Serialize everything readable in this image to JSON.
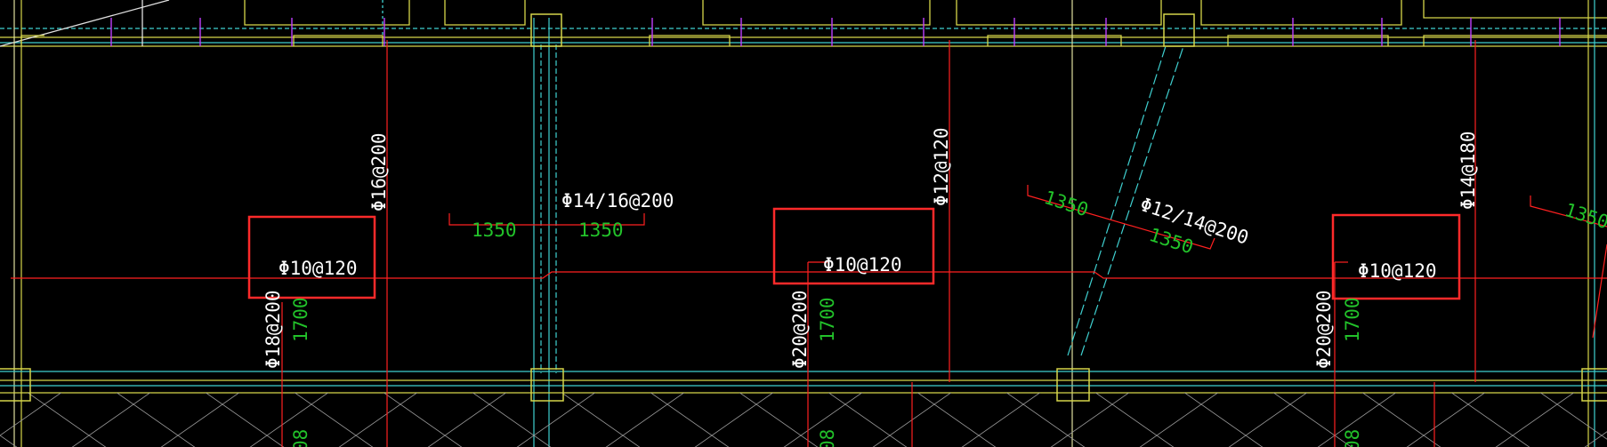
{
  "colors": {
    "background": "#000000",
    "rebar_line": "#ff2020",
    "rebar_label": "#ffffff",
    "length_label": "#22c22a",
    "column": "#d6d64a",
    "axis_line": "#3fd0d0",
    "purple_tick": "#c040ff",
    "highlight_box": "#ff2a2a",
    "grid_line": "#e0e0a0"
  },
  "drawing": {
    "rebar_labels": [
      {
        "id": "l1",
        "text": "Φ16@200"
      },
      {
        "id": "l2",
        "text": "Φ10@120"
      },
      {
        "id": "l3",
        "text": "Φ18@200"
      },
      {
        "id": "l4",
        "text": "Φ14/16@200"
      },
      {
        "id": "l5",
        "text": "Φ10@120"
      },
      {
        "id": "l6",
        "text": "Φ20@200"
      },
      {
        "id": "l7",
        "text": "Φ12@120"
      },
      {
        "id": "l8",
        "text": "Φ12/14@200"
      },
      {
        "id": "l9",
        "text": "Φ14@180"
      },
      {
        "id": "l10",
        "text": "Φ10@120"
      },
      {
        "id": "l11",
        "text": "Φ20@200"
      }
    ],
    "length_labels": [
      {
        "id": "d1",
        "text": "1700"
      },
      {
        "id": "d2",
        "text": "1350"
      },
      {
        "id": "d3",
        "text": "1350"
      },
      {
        "id": "d4",
        "text": "1700"
      },
      {
        "id": "d5",
        "text": "1350"
      },
      {
        "id": "d6",
        "text": "1350"
      },
      {
        "id": "d7",
        "text": "1700"
      },
      {
        "id": "d8",
        "text": "1350"
      }
    ]
  }
}
